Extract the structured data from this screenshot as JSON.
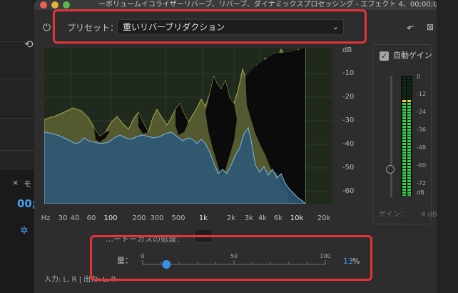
{
  "window": {
    "title": "ーボリュームイコライザーリバーブ、リバーブ、ダイナミックスプロセッシング - エフェクト 4、00;00;00…"
  },
  "preset": {
    "label": "プリセット：",
    "selected": "重いリバーブリダクション"
  },
  "graph": {
    "db_unit": "dB",
    "db_ticks": [
      "-10",
      "-20",
      "-30",
      "-40",
      "-50",
      "-60"
    ],
    "hz_ticks": [
      {
        "label": "Hz",
        "bright": false
      },
      {
        "label": "30",
        "bright": false
      },
      {
        "label": "40",
        "bright": false
      },
      {
        "label": "60",
        "bright": false
      },
      {
        "label": "100",
        "bright": true
      },
      {
        "label": "200",
        "bright": false
      },
      {
        "label": "300",
        "bright": false
      },
      {
        "label": "500",
        "bright": false
      },
      {
        "label": "1k",
        "bright": true
      },
      {
        "label": "2k",
        "bright": false
      },
      {
        "label": "3k",
        "bright": false
      },
      {
        "label": "4k",
        "bright": false
      },
      {
        "label": "6k",
        "bright": false
      },
      {
        "label": "10k",
        "bright": true
      },
      {
        "label": "20k",
        "bright": false
      }
    ],
    "colors": {
      "input": "#6b6b34",
      "output": "#2f5c7a",
      "background": "#1f2a1c"
    }
  },
  "auto_gain": {
    "label": "自動ゲイン",
    "checked": true,
    "meter_labels": [
      "0",
      "-12",
      "-24",
      "-36",
      "-48",
      "-60",
      "-72",
      "dB"
    ],
    "gain_label": "ゲイン：",
    "gain_value": "4 dB"
  },
  "cut_label": "…ートーカスの処理：",
  "amount": {
    "label": "量：",
    "tick_labels": [
      "0",
      "50",
      "100"
    ],
    "value": "13",
    "unit": "%",
    "fraction": 0.13
  },
  "io": "入力: L, R | 出力: L, R",
  "left_panel": {
    "tab_close": "×",
    "tab_label": "モ",
    "timecode": "00;"
  },
  "accent_color": "#4a9df0",
  "highlight_color": "#e5343a"
}
